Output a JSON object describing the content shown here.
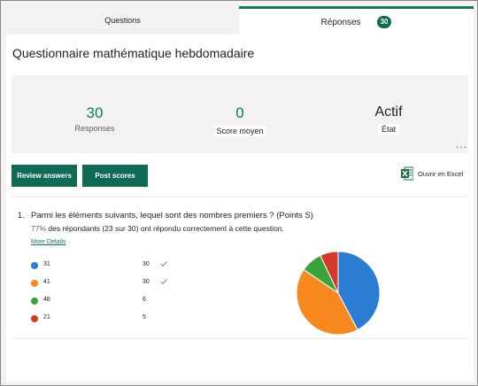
{
  "tabs": {
    "questions_label": "Questions",
    "responses_label": "Réponses",
    "responses_count": "30"
  },
  "form": {
    "title": "Questionnaire mathématique hebdomadaire"
  },
  "summary": {
    "responses_value": "30",
    "responses_caption": "Responses",
    "score_value": "0",
    "score_caption": "Score moyen",
    "status_value": "Actif",
    "status_caption": "État",
    "more_label": "..."
  },
  "actions": {
    "review_label": "Review answers",
    "post_label": "Post scores",
    "excel_label": "Ouvrir en Excel"
  },
  "question": {
    "number": "1.",
    "text": "Parmi les éléments suivants, lequel sont des nombres premiers ? (Points S)",
    "percent": "77%",
    "stat_text": "des répondants (23 sur 30) ont répondu correctement à cette question.",
    "more_details": "More Details"
  },
  "colors": {
    "accent": "#0f6b54",
    "blue": "#2b7cd3",
    "orange": "#f7891e",
    "green": "#3aa33a",
    "red": "#d33a2c"
  },
  "chart_data": {
    "type": "pie",
    "categories": [
      "31",
      "41",
      "48",
      "21"
    ],
    "values": [
      30,
      30,
      6,
      5
    ],
    "correct": [
      true,
      true,
      false,
      false
    ],
    "colors": [
      "#2b7cd3",
      "#f7891e",
      "#3aa33a",
      "#d33a2c"
    ]
  }
}
